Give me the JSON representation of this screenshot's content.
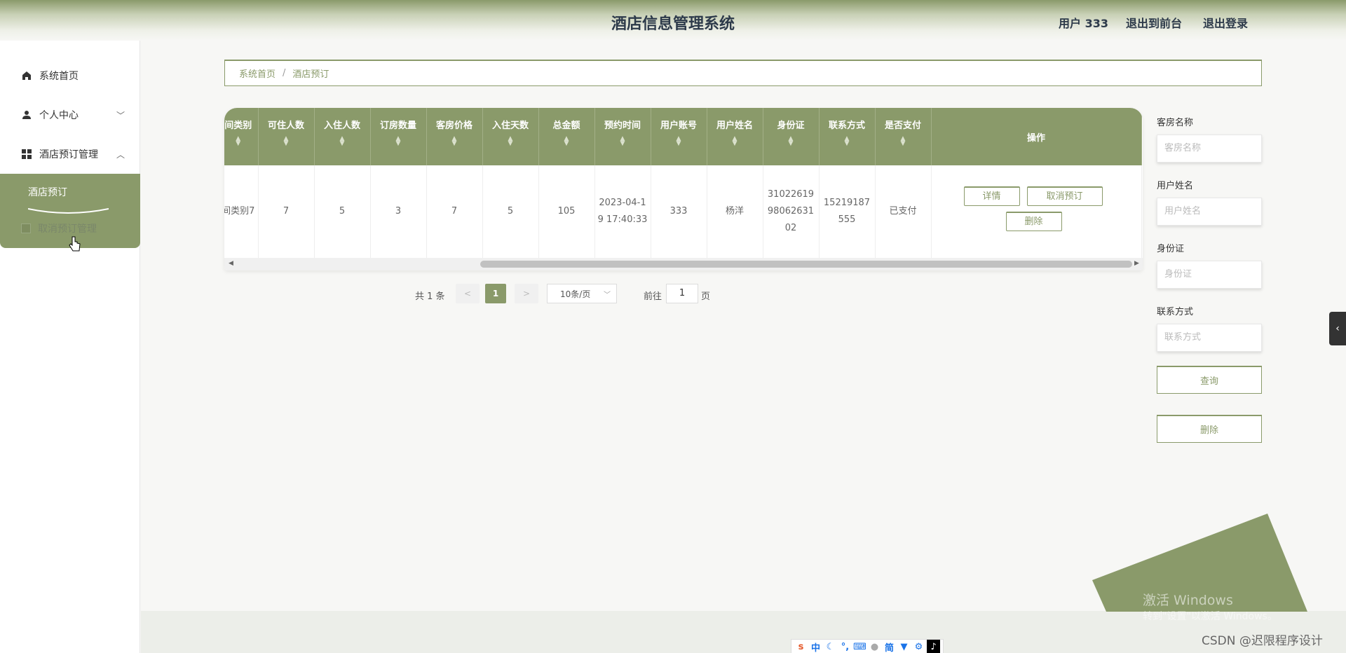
{
  "header": {
    "title": "酒店信息管理系统",
    "user_label": "用户 333",
    "front_link": "退出到前台",
    "logout_link": "退出登录"
  },
  "sidebar": {
    "items": [
      {
        "label": "系统首页",
        "icon": "home-icon"
      },
      {
        "label": "个人中心",
        "icon": "user-icon"
      },
      {
        "label": "酒店预订管理",
        "icon": "grid-icon"
      },
      {
        "label": "酒店预订",
        "icon": ""
      },
      {
        "label": "取消预订管理",
        "icon": "grid-icon"
      }
    ]
  },
  "breadcrumb": {
    "home": "系统首页",
    "sep": "/",
    "current": "酒店预订"
  },
  "table": {
    "columns": [
      "间类别",
      "可住人数",
      "入住人数",
      "订房数量",
      "客房价格",
      "入住天数",
      "总金额",
      "预约时间",
      "用户账号",
      "用户姓名",
      "身份证",
      "联系方式",
      "是否支付",
      "操作"
    ],
    "rows": [
      [
        "间类别7",
        "7",
        "5",
        "3",
        "7",
        "5",
        "105",
        "2023-04-19 17:40:33",
        "333",
        "杨洋",
        "310226199806263102",
        "15219187555",
        "已支付",
        ""
      ]
    ],
    "actions": {
      "detail": "详情",
      "cancel": "取消预订",
      "delete": "删除"
    }
  },
  "pagination": {
    "total_text": "共 1 条",
    "prev": "<",
    "current": "1",
    "next": ">",
    "page_size": "10条/页",
    "goto_label": "前往",
    "goto_value": "1",
    "page_suffix": "页"
  },
  "search": {
    "fields": [
      {
        "label": "客房名称",
        "placeholder": "客房名称"
      },
      {
        "label": "用户姓名",
        "placeholder": "用户姓名"
      },
      {
        "label": "身份证",
        "placeholder": "身份证"
      },
      {
        "label": "联系方式",
        "placeholder": "联系方式"
      }
    ],
    "query_button": "查询",
    "delete_button": "删除"
  },
  "overlay": {
    "activate_title": "激活 Windows",
    "activate_sub": "转到\"设置\"以激活 Windows。",
    "watermark": "CSDN @迟限程序设计"
  },
  "taskbar": {
    "icons": [
      "中",
      "简"
    ]
  },
  "colors": {
    "accent": "#8a9a6a",
    "header_text": "#2d3a4a"
  }
}
